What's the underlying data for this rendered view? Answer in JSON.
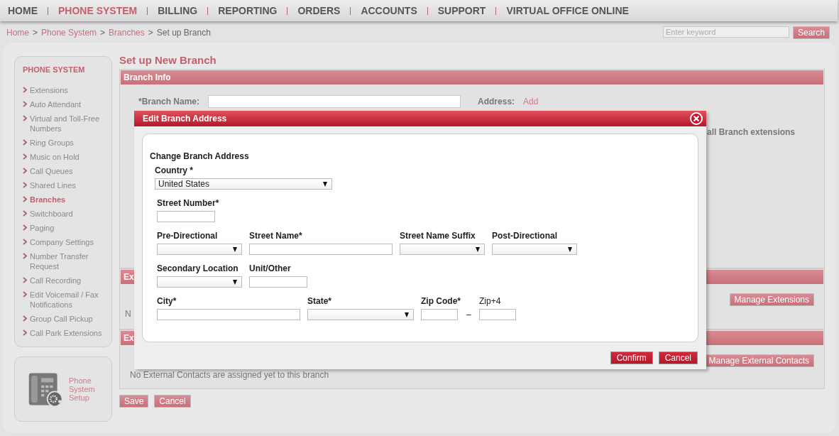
{
  "nav": [
    {
      "label": "HOME",
      "selected": false
    },
    {
      "label": "PHONE SYSTEM",
      "selected": true
    },
    {
      "label": "BILLING",
      "selected": false
    },
    {
      "label": "REPORTING",
      "selected": false
    },
    {
      "label": "ORDERS",
      "selected": false
    },
    {
      "label": "ACCOUNTS",
      "selected": false
    },
    {
      "label": "SUPPORT",
      "selected": false
    },
    {
      "label": "VIRTUAL OFFICE ONLINE",
      "selected": false
    }
  ],
  "breadcrumb": {
    "separator": ">",
    "items": [
      {
        "label": "Home",
        "link": true
      },
      {
        "label": "Phone System",
        "link": true
      },
      {
        "label": "Branches",
        "link": true
      },
      {
        "label": "Set up Branch",
        "link": false
      }
    ]
  },
  "search": {
    "placeholder": "Enter keyword",
    "button": "Search"
  },
  "sidebar": {
    "title": "PHONE SYSTEM",
    "items": [
      {
        "label": "Extensions",
        "selected": false
      },
      {
        "label": "Auto Attendant",
        "selected": false
      },
      {
        "label": "Virtual and Toll-Free Numbers",
        "selected": false
      },
      {
        "label": "Ring Groups",
        "selected": false
      },
      {
        "label": "Music on Hold",
        "selected": false
      },
      {
        "label": "Call Queues",
        "selected": false
      },
      {
        "label": "Shared Lines",
        "selected": false
      },
      {
        "label": "Branches",
        "selected": true
      },
      {
        "label": "Switchboard",
        "selected": false
      },
      {
        "label": "Paging",
        "selected": false
      },
      {
        "label": "Company Settings",
        "selected": false
      },
      {
        "label": "Number Transfer Request",
        "selected": false
      },
      {
        "label": "Call Recording",
        "selected": false
      },
      {
        "label": "Edit Voicemail / Fax Notifications",
        "selected": false
      },
      {
        "label": "Group Call Pickup",
        "selected": false
      },
      {
        "label": "Call Park Extensions",
        "selected": false
      }
    ],
    "setup_card": {
      "label": "Phone System Setup"
    }
  },
  "page_title": "Set up New Branch",
  "branch_info": {
    "header": "Branch Info",
    "name_label": "*Branch Name:",
    "address_label": "Address:",
    "address_link": "Add",
    "note": "all Branch extensions"
  },
  "extensions_section": {
    "header": "Ex",
    "button": "Manage Extensions",
    "text": "N"
  },
  "contacts_section": {
    "header": "Ex",
    "button": "Manage External Contacts",
    "text": "No External Contacts are assigned yet to this branch"
  },
  "page_buttons": [
    "Save",
    "Cancel"
  ],
  "modal": {
    "title": "Edit Branch Address",
    "heading": "Change Branch Address",
    "rows": [
      [
        {
          "label": "Country *",
          "kind": "select",
          "value": "United States"
        }
      ],
      [
        {
          "label": "Street Number*",
          "kind": "input"
        }
      ],
      [
        {
          "label": "Pre-Directional",
          "kind": "select"
        },
        {
          "label": "Street Name*",
          "kind": "input"
        },
        {
          "label": "Street Name Suffix",
          "kind": "select"
        },
        {
          "label": "Post-Directional",
          "kind": "select"
        }
      ],
      [
        {
          "label": "Secondary Location",
          "kind": "select"
        },
        {
          "label": "Unit/Other",
          "kind": "input"
        }
      ],
      [
        {
          "label": "City*",
          "kind": "input"
        },
        {
          "label": "State*",
          "kind": "select"
        },
        {
          "label": "Zip Code*",
          "kind": "input",
          "suffix": "–"
        },
        {
          "label": "Zip+4",
          "kind": "input",
          "plain": true
        }
      ]
    ],
    "buttons": [
      "Confirm",
      "Cancel"
    ]
  }
}
